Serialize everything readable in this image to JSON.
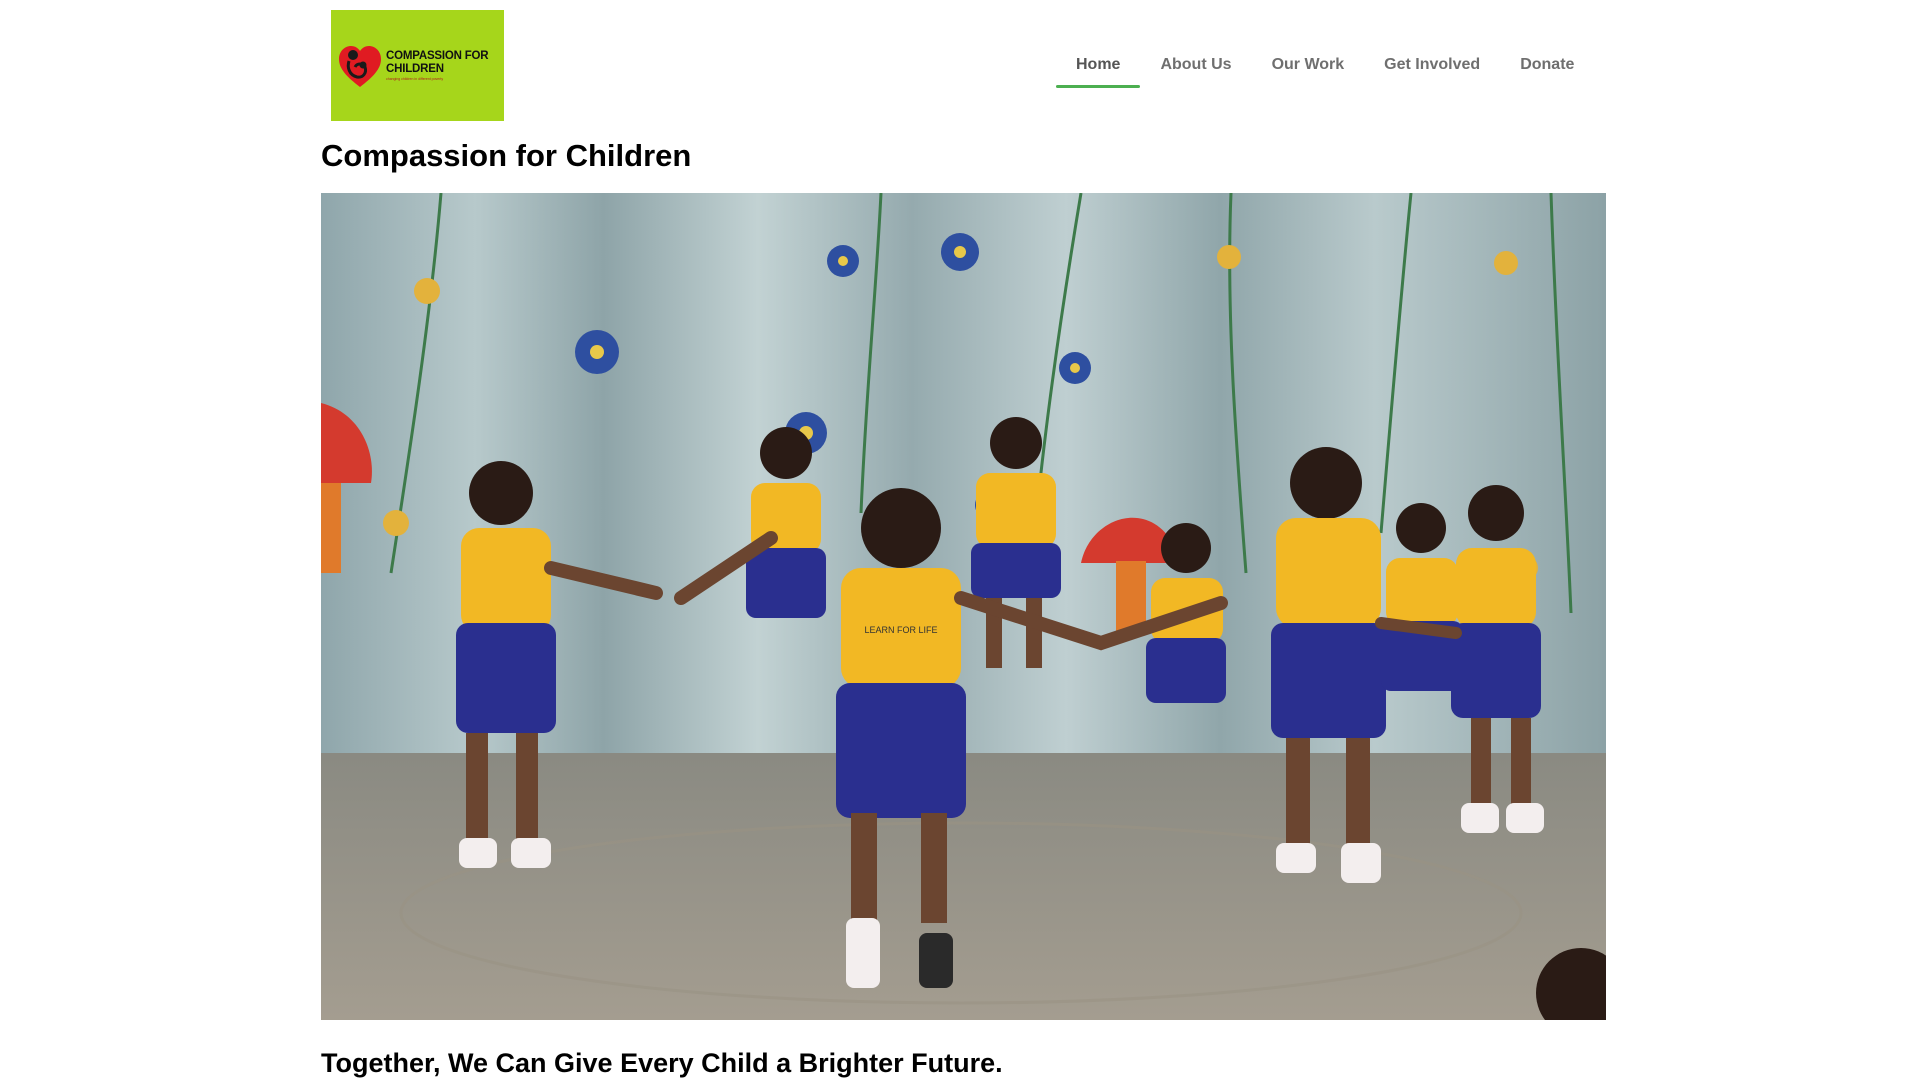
{
  "logo": {
    "title_line1": "COMPASSION FOR",
    "title_line2": "CHILDREN",
    "tagline": "changing children in different poverty",
    "background": "#a6d61b",
    "icon": "heart-mother-child-icon"
  },
  "nav": {
    "items": [
      {
        "label": "Home",
        "active": true
      },
      {
        "label": "About Us",
        "active": false
      },
      {
        "label": "Our Work",
        "active": false
      },
      {
        "label": "Get Involved",
        "active": false
      },
      {
        "label": "Donate",
        "active": false
      }
    ],
    "active_color": "#4caf50"
  },
  "site": {
    "title": "Compassion for Children"
  },
  "hero": {
    "shirt_text": "LEARN FOR LIFE"
  },
  "section": {
    "heading": "Together, We Can Give Every Child a Brighter Future."
  }
}
